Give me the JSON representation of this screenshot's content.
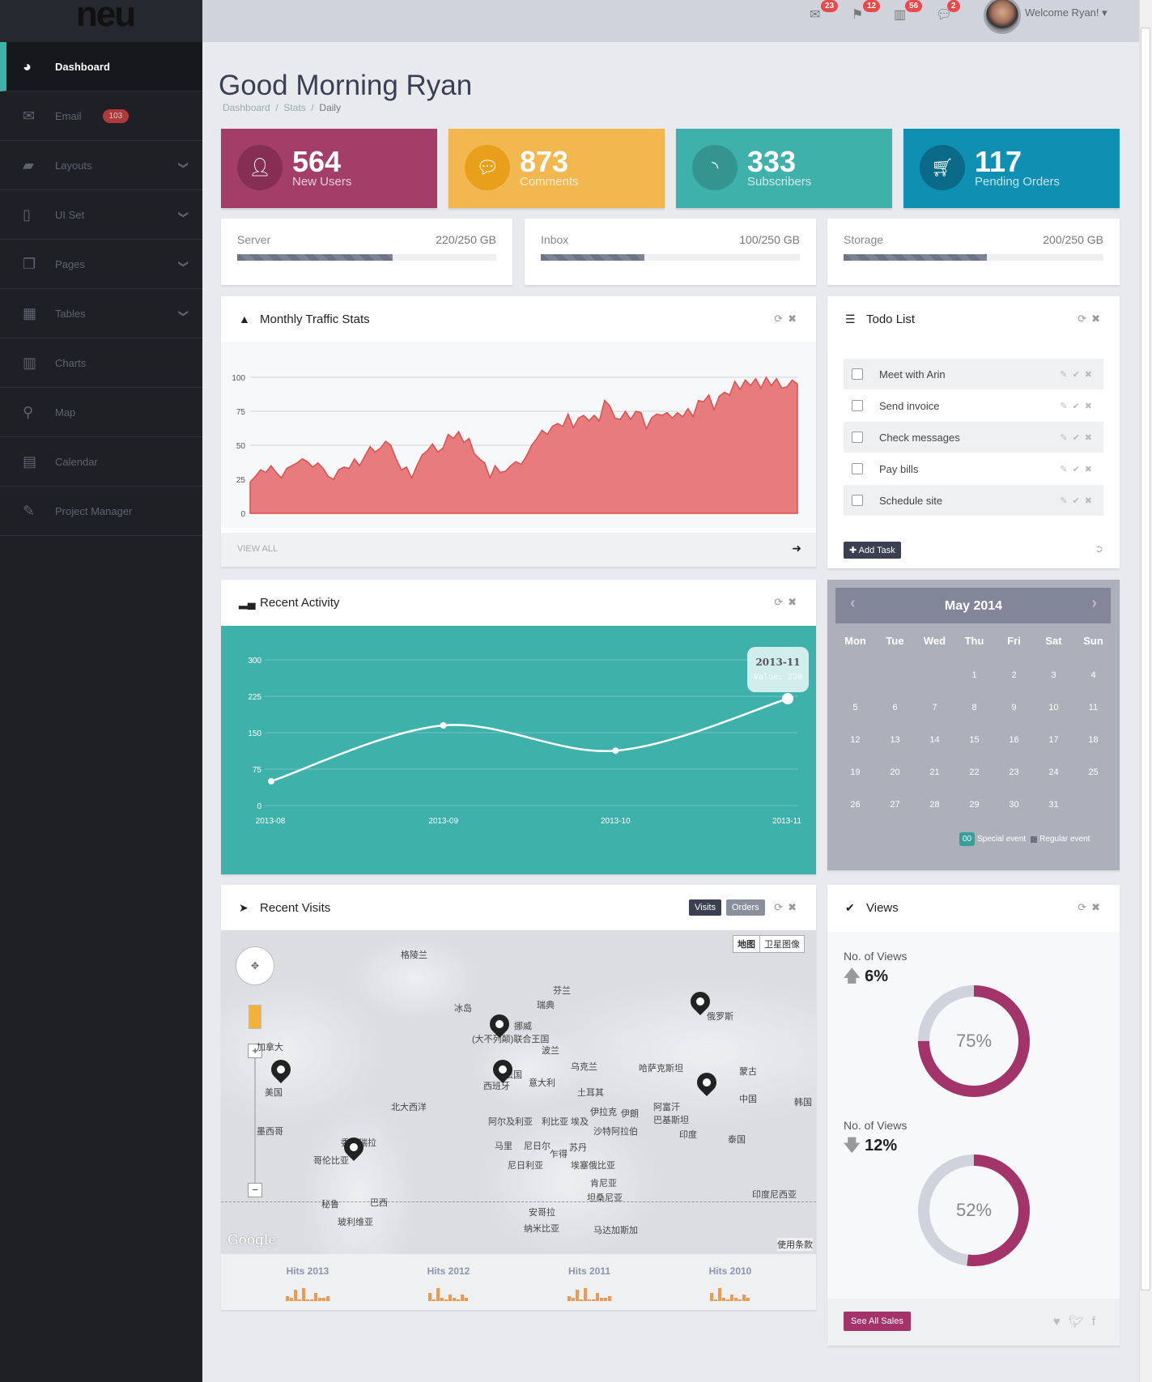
{
  "brand": {
    "logo": "neu"
  },
  "sidebar": {
    "items": [
      {
        "label": "Dashboard",
        "icon": "dashboard-icon",
        "active": true
      },
      {
        "label": "Email",
        "icon": "envelope-icon",
        "badge": "103"
      },
      {
        "label": "Layouts",
        "icon": "folder-icon",
        "chevron": true
      },
      {
        "label": "UI Set",
        "icon": "mobile-icon",
        "chevron": true
      },
      {
        "label": "Pages",
        "icon": "copy-icon",
        "chevron": true
      },
      {
        "label": "Tables",
        "icon": "table-icon",
        "chevron": true
      },
      {
        "label": "Charts",
        "icon": "bar-chart-icon"
      },
      {
        "label": "Map",
        "icon": "map-marker-icon"
      },
      {
        "label": "Calendar",
        "icon": "calendar-icon"
      },
      {
        "label": "Project Manager",
        "icon": "edit-icon"
      }
    ]
  },
  "topbar": {
    "notifications": [
      {
        "icon": "envelope-icon",
        "count": "23"
      },
      {
        "icon": "flag-icon",
        "count": "12"
      },
      {
        "icon": "bar-chart-icon",
        "count": "56"
      },
      {
        "icon": "comment-icon",
        "count": "2"
      }
    ],
    "welcome": "Welcome Ryan!"
  },
  "page": {
    "title": "Good Morning Ryan",
    "breadcrumb": [
      "Dashboard",
      "Stats",
      "Daily"
    ]
  },
  "tiles": [
    {
      "value": "564",
      "label": "New Users",
      "icon": "user-icon",
      "color": "#a23e67",
      "circle": "#862e55"
    },
    {
      "value": "873",
      "label": "Comments",
      "icon": "comment-icon",
      "color": "#f2b84f",
      "circle": "#e8a01a"
    },
    {
      "value": "333",
      "label": "Subscribers",
      "icon": "rss-icon",
      "color": "#3fb1ab",
      "circle": "#349590"
    },
    {
      "value": "117",
      "label": "Pending Orders",
      "icon": "cart-icon",
      "color": "#0e90b3",
      "circle": "#0b6a87"
    }
  ],
  "storage": [
    {
      "label": "Server",
      "value": "220/250 GB",
      "fraction": 0.6
    },
    {
      "label": "Inbox",
      "value": "100/250 GB",
      "fraction": 0.4
    },
    {
      "label": "Storage",
      "value": "200/250 GB",
      "fraction": 0.55
    }
  ],
  "traffic": {
    "title": "Monthly Traffic Stats",
    "footer": "VIEW ALL"
  },
  "todo": {
    "title": "Todo List",
    "items": [
      "Meet with Arin",
      "Send invoice",
      "Check messages",
      "Pay bills",
      "Schedule site"
    ],
    "add_label": "Add Task"
  },
  "activity": {
    "title": "Recent Activity",
    "tooltip": {
      "title": "2013-11",
      "value": "Value: 220"
    }
  },
  "calendar": {
    "month": "May 2014",
    "weekdays": [
      "Mon",
      "Tue",
      "Wed",
      "Thu",
      "Fri",
      "Sat",
      "Sun"
    ],
    "first_weekday": 3,
    "days": 31,
    "legend": {
      "badge": "00",
      "special": "Special event",
      "regular": "Regular event"
    }
  },
  "visits": {
    "title": "Recent Visits",
    "tabs": [
      "Visits",
      "Orders"
    ],
    "map_types": [
      "地图",
      "卫星图像"
    ],
    "map_terms": "使用条款",
    "map_logo": "Google",
    "map_labels": [
      "格陵兰",
      "冰岛",
      "芬兰",
      "瑞典",
      "挪威",
      "(大不列颠)联合王国",
      "波兰",
      "乌克兰",
      "法国",
      "意大利",
      "西班牙",
      "哈萨克斯坦",
      "俄罗斯",
      "蒙古",
      "中国",
      "韩国",
      "土耳其",
      "伊拉克",
      "伊朗",
      "阿富汗",
      "巴基斯坦",
      "印度",
      "泰国",
      "加拿大",
      "美国",
      "墨西哥",
      "北大西洋",
      "阿尔及利亚",
      "利比亚",
      "埃及",
      "沙特阿拉伯",
      "马里",
      "尼日尔",
      "乍得",
      "苏丹",
      "尼日利亚",
      "埃塞俄比亚",
      "肯尼亚",
      "坦桑尼亚",
      "安哥拉",
      "纳米比亚",
      "马达加斯加",
      "委内瑞拉",
      "哥伦比亚",
      "巴西",
      "秘鲁",
      "玻利维亚",
      "印度尼西亚"
    ],
    "hits": [
      {
        "label": "Hits 2013",
        "values": [
          3,
          2,
          7,
          1,
          8,
          1,
          1,
          5,
          2,
          2,
          3
        ]
      },
      {
        "label": "Hits 2012",
        "values": [
          5,
          1,
          8,
          2,
          1,
          4,
          2,
          1,
          4,
          2
        ]
      },
      {
        "label": "Hits 2011",
        "values": [
          3,
          2,
          7,
          1,
          8,
          1,
          1,
          5,
          2,
          2,
          3
        ]
      },
      {
        "label": "Hits 2010",
        "values": [
          5,
          1,
          8,
          2,
          1,
          4,
          2,
          1,
          4,
          2
        ]
      }
    ]
  },
  "views": {
    "title": "Views",
    "stats": [
      {
        "label": "No. of Views",
        "change": "6%",
        "direction": "up",
        "percent": 75,
        "display": "75%"
      },
      {
        "label": "No. of Views",
        "change": "12%",
        "direction": "down",
        "percent": 52,
        "display": "52%"
      }
    ],
    "button": "See All Sales"
  },
  "chart_data": [
    {
      "type": "area",
      "title": "Monthly Traffic Stats",
      "ylim": [
        0,
        100
      ],
      "yticks": [
        0,
        25,
        50,
        75,
        100
      ],
      "color": "#e87b7b",
      "values": [
        23,
        27,
        32,
        30,
        35,
        30,
        26,
        33,
        35,
        37,
        40,
        38,
        34,
        37,
        33,
        27,
        25,
        32,
        34,
        33,
        40,
        35,
        42,
        49,
        45,
        48,
        53,
        50,
        40,
        32,
        34,
        26,
        35,
        43,
        46,
        51,
        45,
        48,
        58,
        55,
        60,
        52,
        55,
        44,
        40,
        37,
        26,
        35,
        30,
        31,
        35,
        38,
        36,
        42,
        50,
        55,
        61,
        58,
        64,
        66,
        64,
        73,
        63,
        70,
        72,
        68,
        72,
        68,
        83,
        79,
        70,
        69,
        75,
        69,
        75,
        74,
        62,
        70,
        73,
        72,
        74,
        70,
        74,
        71,
        77,
        71,
        83,
        82,
        87,
        76,
        86,
        89,
        87,
        97,
        91,
        98,
        94,
        99,
        92,
        100,
        94,
        99,
        92,
        93,
        98,
        95
      ]
    },
    {
      "type": "line",
      "categories": [
        "2013-08",
        "2013-09",
        "2013-10",
        "2013-11"
      ],
      "values": [
        50,
        165,
        113,
        220
      ],
      "ylim": [
        0,
        300
      ],
      "yticks": [
        0,
        75,
        150,
        225,
        300
      ]
    }
  ]
}
